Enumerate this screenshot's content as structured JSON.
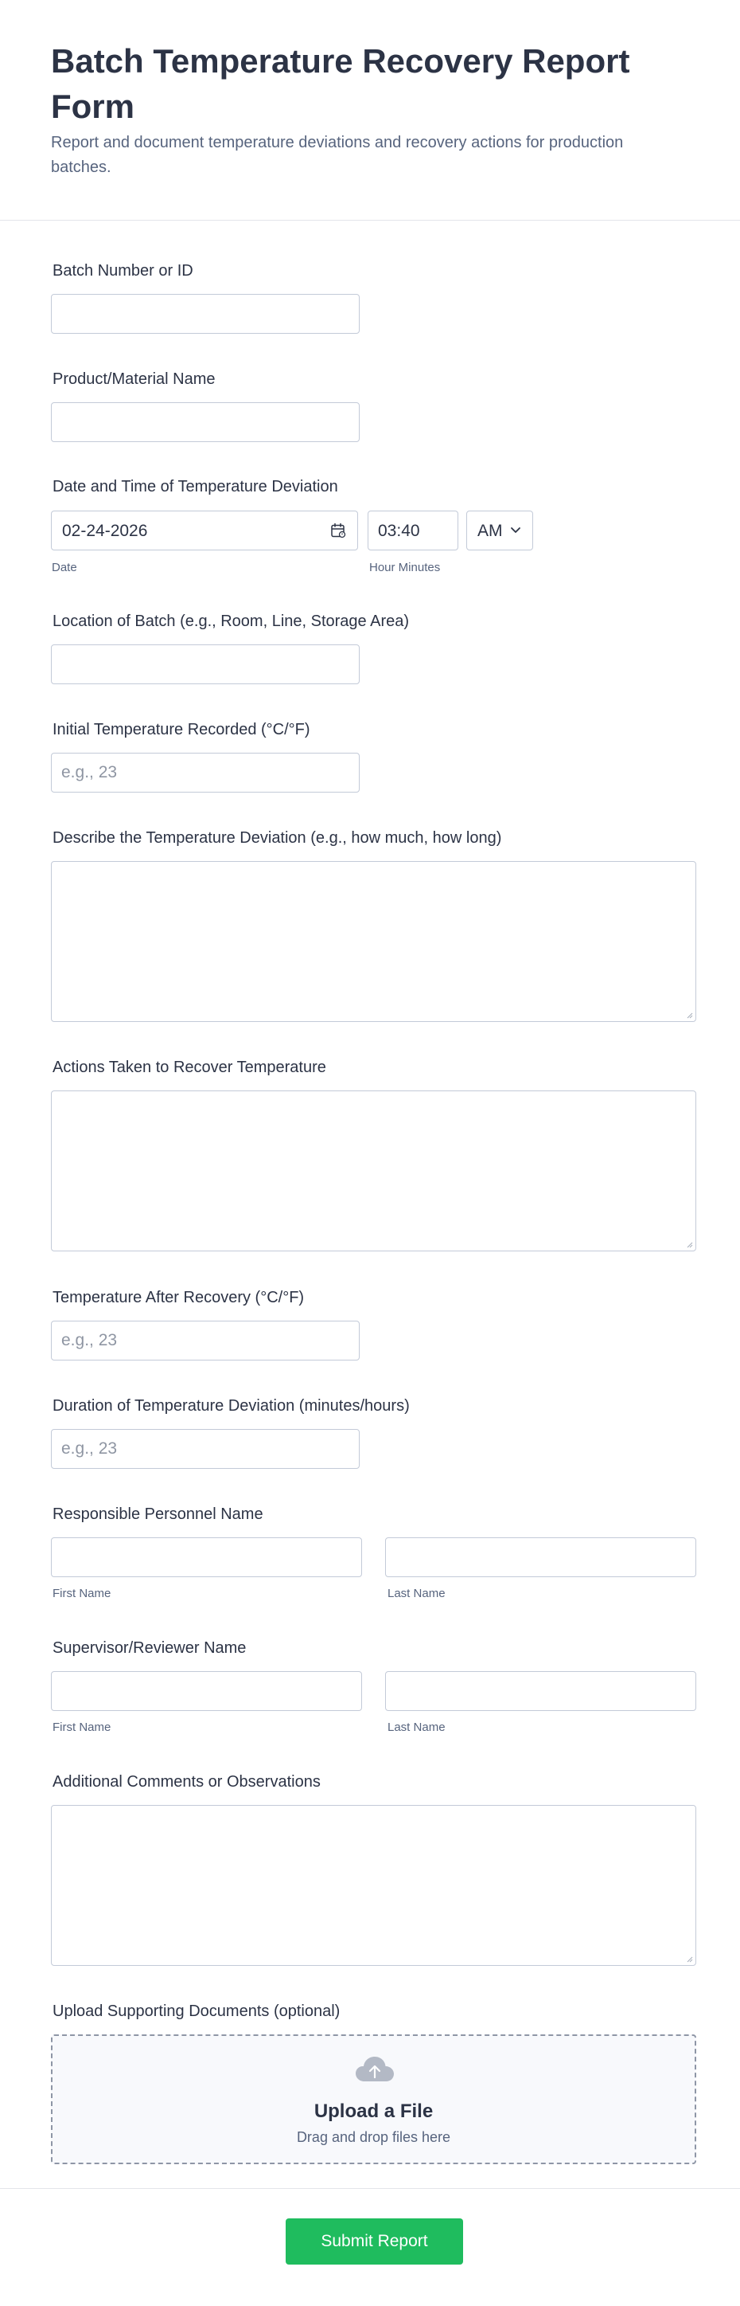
{
  "form": {
    "title": "Batch Temperature Recovery Report Form",
    "subtitle": "Report and document temperature deviations and recovery actions for production batches."
  },
  "fields": {
    "batch_number": {
      "label": "Batch Number or ID",
      "value": ""
    },
    "product_name": {
      "label": "Product/Material Name",
      "value": ""
    },
    "deviation_datetime": {
      "label": "Date and Time of Temperature Deviation",
      "date_value": "02-24-2026",
      "time_value": "03:40",
      "ampm_value": "AM",
      "date_sublabel": "Date",
      "time_sublabel": "Hour Minutes"
    },
    "location": {
      "label": "Location of Batch (e.g., Room, Line, Storage Area)",
      "value": ""
    },
    "initial_temperature": {
      "label": "Initial Temperature Recorded (°C/°F)",
      "placeholder": "e.g., 23"
    },
    "deviation_description": {
      "label": "Describe the Temperature Deviation (e.g., how much, how long)"
    },
    "recovery_actions": {
      "label": "Actions Taken to Recover Temperature"
    },
    "temperature_after": {
      "label": "Temperature After Recovery (°C/°F)",
      "placeholder": "e.g., 23"
    },
    "deviation_duration": {
      "label": "Duration of Temperature Deviation (minutes/hours)",
      "placeholder": "e.g., 23"
    },
    "responsible_personnel": {
      "label": "Responsible Personnel Name",
      "first_sublabel": "First Name",
      "last_sublabel": "Last Name"
    },
    "supervisor": {
      "label": "Supervisor/Reviewer Name",
      "first_sublabel": "First Name",
      "last_sublabel": "Last Name"
    },
    "comments": {
      "label": "Additional Comments or Observations"
    },
    "upload": {
      "label": "Upload Supporting Documents (optional)",
      "title": "Upload a File",
      "subtitle": "Drag and drop files here",
      "icon": "cloud-upload-icon"
    }
  },
  "submit": {
    "label": "Submit Report",
    "color": "#1fbc5e"
  },
  "icons": {
    "date": "calendar-icon",
    "ampm": "chevron-down-icon"
  }
}
